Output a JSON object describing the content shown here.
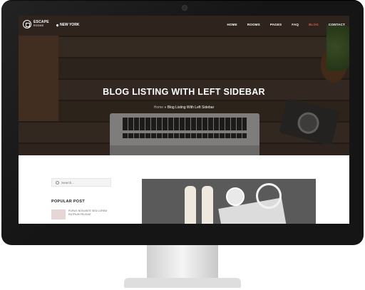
{
  "brand": {
    "name": "ESCAPE",
    "sub": "ROOMS"
  },
  "location": "NEW YORK",
  "nav": [
    {
      "label": "HOME",
      "active": false
    },
    {
      "label": "ROOMS",
      "active": false
    },
    {
      "label": "PAGES",
      "active": false
    },
    {
      "label": "FAQ",
      "active": false
    },
    {
      "label": "BLOG",
      "active": true
    },
    {
      "label": "CONTACT",
      "active": false
    }
  ],
  "hero": {
    "title": "BLOG LISTING WITH LEFT SIDEBAR",
    "breadcrumb_home": "Home",
    "breadcrumb_sep": "»",
    "breadcrumb_current": "Blog Listing With Left Sidebar"
  },
  "sidebar": {
    "search_placeholder": "Search...",
    "popular_title": "POPULAR POST",
    "post_title": "PURUS NON ANTE SED LOREM RUTRUM FEUGIAT"
  },
  "colors": {
    "accent": "#e05a4e",
    "frame": "#151515"
  },
  "icons": [
    "logo-mark-icon",
    "location-pin-icon",
    "search-icon"
  ]
}
